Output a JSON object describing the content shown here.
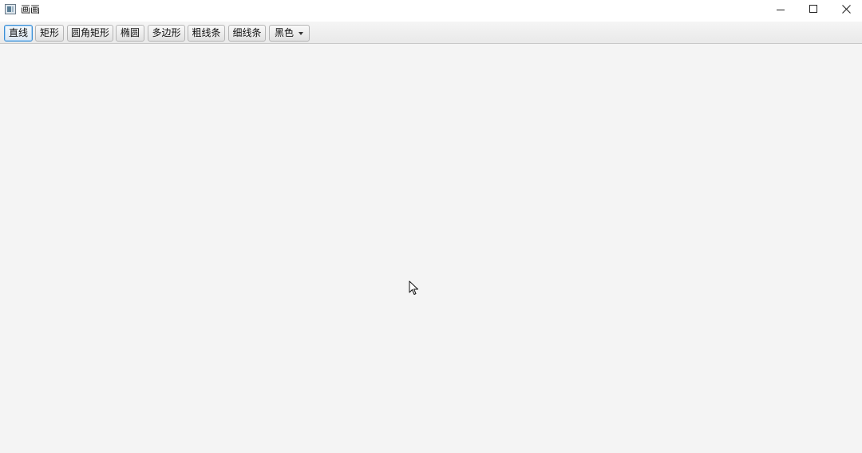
{
  "window": {
    "title": "画画",
    "icon": "app-window-icon"
  },
  "toolbar": {
    "tools": [
      {
        "label": "直线",
        "selected": true
      },
      {
        "label": "矩形",
        "selected": false
      },
      {
        "label": "圆角矩形",
        "selected": false
      },
      {
        "label": "椭圆",
        "selected": false
      },
      {
        "label": "多边形",
        "selected": false
      },
      {
        "label": "粗线条",
        "selected": false
      },
      {
        "label": "细线条",
        "selected": false
      }
    ],
    "color_select": {
      "value": "黑色"
    }
  },
  "colors": {
    "accent": "#3a8fd6",
    "canvas": "#f4f4f4"
  }
}
